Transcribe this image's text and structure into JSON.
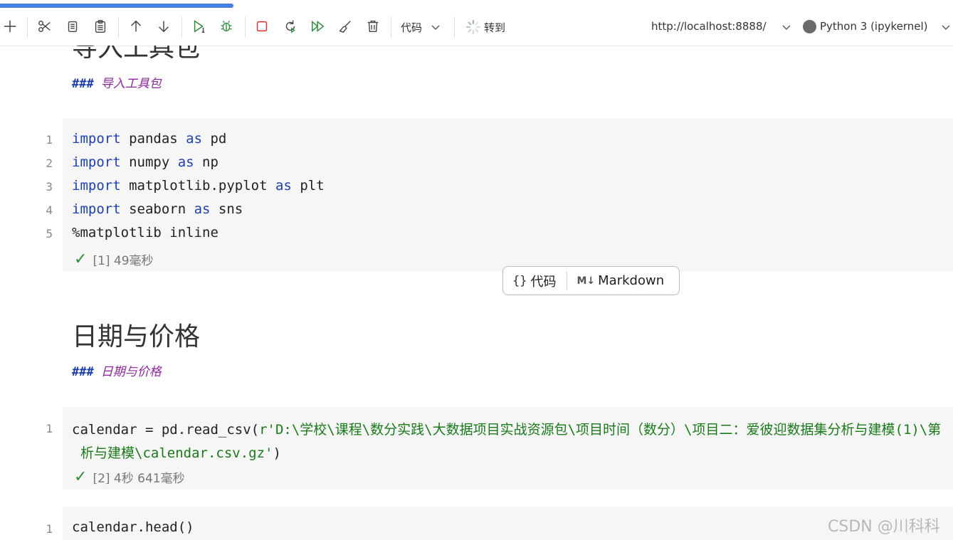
{
  "progress": {
    "fraction": 0.245
  },
  "toolbar": {
    "cell_type": "代码",
    "goto_label": "转到",
    "server_url": "http://localhost:8888/",
    "kernel_name": "Python 3 (ipykernel)"
  },
  "cells": {
    "md1": {
      "heading": "导入工具包",
      "sub_hash": "###",
      "sub_text": "导入工具包"
    },
    "code1": {
      "lines": [
        {
          "num": "1",
          "kw1": "import",
          "mod": " pandas ",
          "kw2": "as",
          "alias": " pd"
        },
        {
          "num": "2",
          "kw1": "import",
          "mod": " numpy ",
          "kw2": "as",
          "alias": " np"
        },
        {
          "num": "3",
          "kw1": "import",
          "mod": " matplotlib.pyplot ",
          "kw2": "as",
          "alias": " plt"
        },
        {
          "num": "4",
          "kw1": "import",
          "mod": " seaborn ",
          "kw2": "as",
          "alias": " sns"
        },
        {
          "num": "5",
          "text": "%matplotlib inline"
        }
      ],
      "status": "[1] 49毫秒"
    },
    "add_cell": {
      "code_icon": "{}",
      "code_label": "代码",
      "md_icon": "M↓",
      "md_label": "Markdown"
    },
    "md2": {
      "heading": "日期与价格",
      "sub_hash": "###",
      "sub_text": "日期与价格"
    },
    "code2": {
      "num": "1",
      "line1_pre": "calendar = pd.read_csv(",
      "line1_str": "r'D:\\学校\\课程\\数分实践\\大数据项目实战资源包\\项目时间（数分）\\项目二：爱彼迎数据集分析与建模(1)\\第",
      "line2_str": "析与建模\\calendar.csv.gz'",
      "line2_post": ")",
      "status": "[2] 4秒 641毫秒"
    },
    "code3": {
      "num": "1",
      "text": "calendar.head()"
    }
  },
  "watermark": "CSDN @川科科",
  "colors": {
    "accent": "#4a7fe6",
    "keyword": "#1e3fb0",
    "string": "#1a7a1a",
    "success": "#2e8b3a"
  },
  "icons": [
    "add-icon",
    "cut-icon",
    "copy-icon",
    "paste-icon",
    "move-up-icon",
    "move-down-icon",
    "run-cell-icon",
    "debug-icon",
    "stop-icon",
    "restart-icon",
    "run-all-icon",
    "clear-outputs-icon",
    "delete-icon"
  ]
}
